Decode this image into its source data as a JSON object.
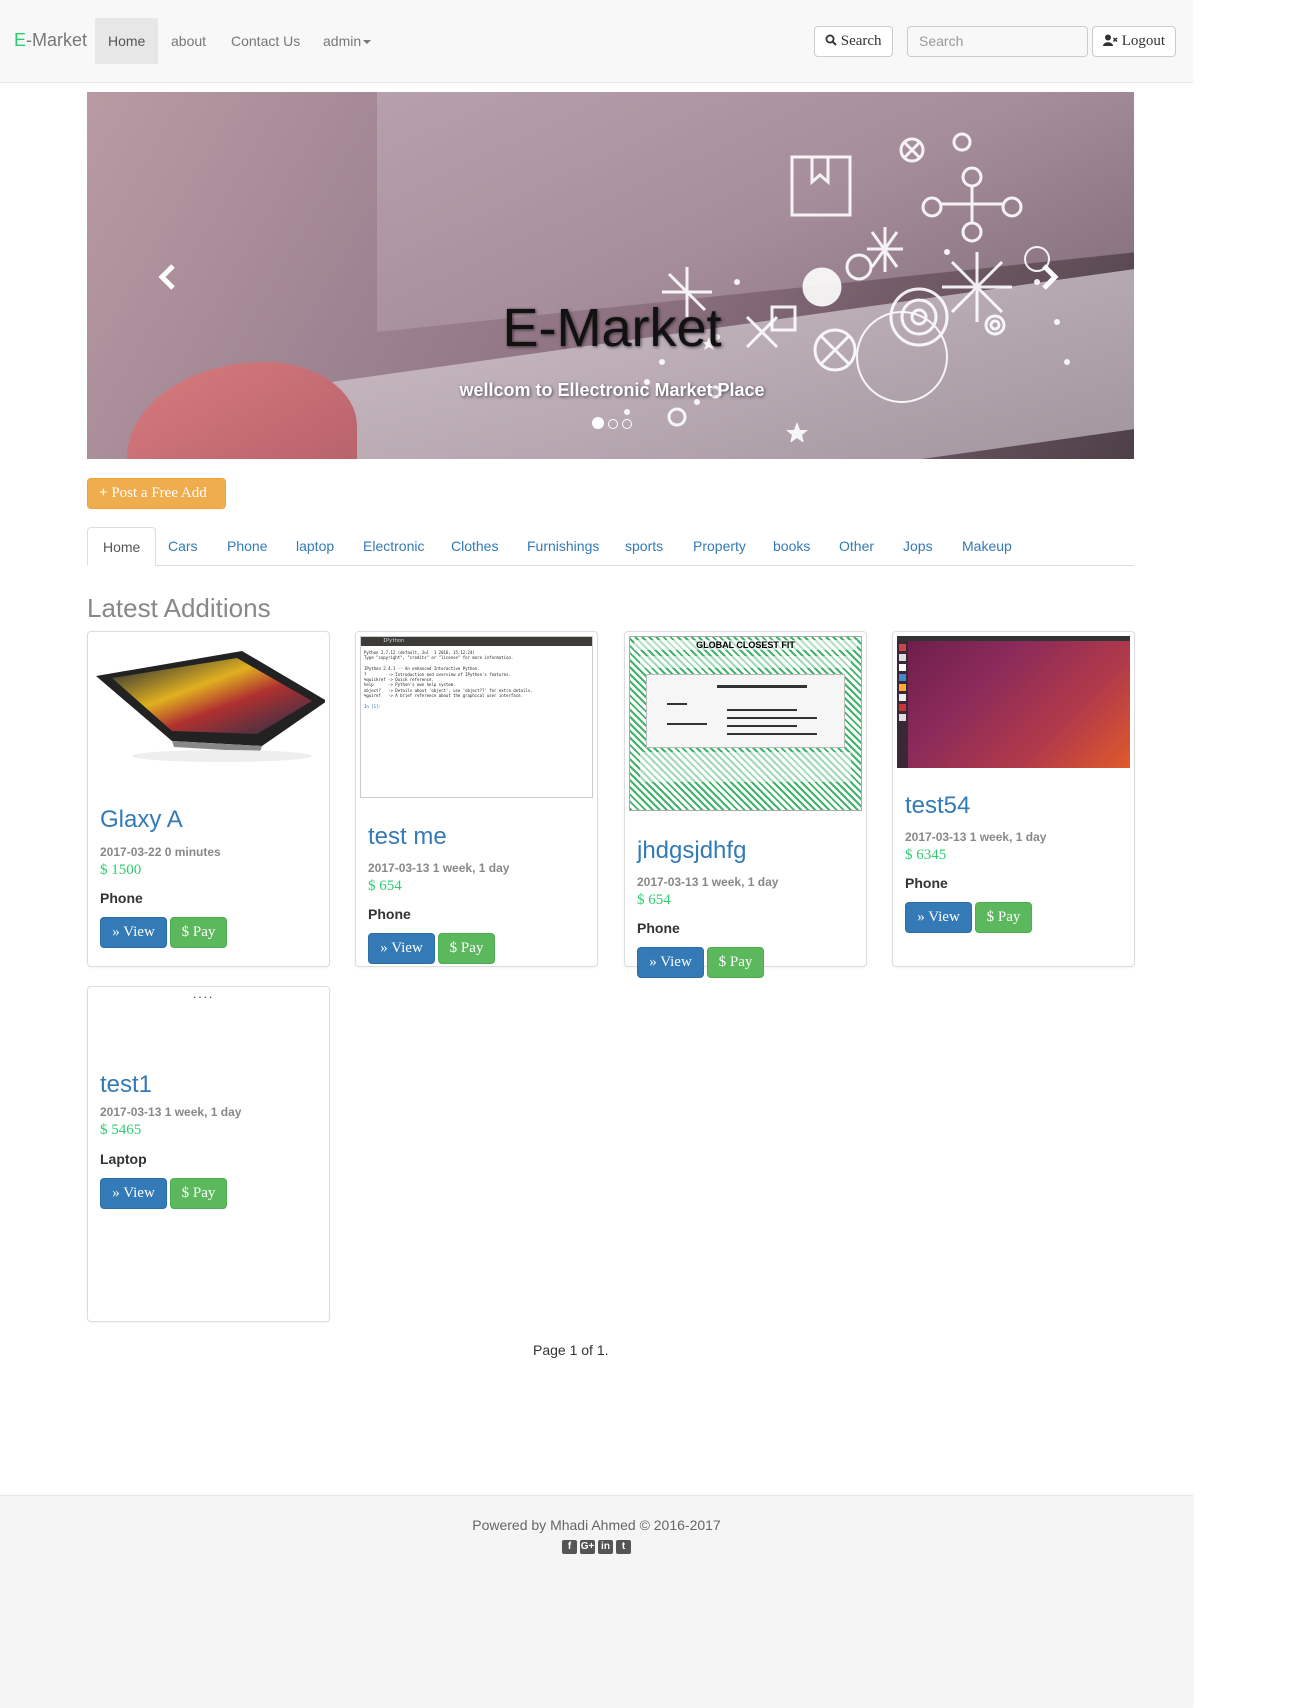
{
  "navbar": {
    "brand_e": "E",
    "brand_rest": "-Market",
    "items": [
      {
        "label": "Home",
        "active": true
      },
      {
        "label": "about"
      },
      {
        "label": "Contact Us"
      },
      {
        "label": "admin"
      }
    ],
    "search_button": "Search",
    "search_placeholder": "Search",
    "logout_button": "Logout"
  },
  "carousel": {
    "title": "E-Market",
    "subtitle": "wellcom to Ellectronic Market Place",
    "slide_count": 3,
    "active_slide": 1
  },
  "post_button": "Post a Free Add",
  "tabs": [
    "Home",
    "Cars",
    "Phone",
    "laptop",
    "Electronic",
    "Clothes",
    "Furnishings",
    "sports",
    "Property",
    "books",
    "Other",
    "Jops",
    "Makeup"
  ],
  "section_title": "Latest Additions",
  "cards": [
    {
      "title": "Glaxy A",
      "date": "2017-03-22 0 minutes",
      "price": "1500",
      "category": "Phone"
    },
    {
      "title": "test me",
      "date": "2017-03-13 1 week, 1 day",
      "price": "654",
      "category": "Phone"
    },
    {
      "title": "jhdgsjdhfg",
      "date": "2017-03-13 1 week, 1 day",
      "price": "654",
      "category": "Phone"
    },
    {
      "title": "test54",
      "date": "2017-03-13 1 week, 1 day",
      "price": "6345",
      "category": "Phone"
    },
    {
      "title": "test1",
      "date": "2017-03-13 1 week, 1 day",
      "price": "5465",
      "category": "Laptop"
    }
  ],
  "buttons": {
    "view": "View",
    "pay": "Pay",
    "currency": "$"
  },
  "thumb_text": {
    "formula_heading": "GLOBAL CLOSEST FIT",
    "ipython_title": "IPython",
    "ipython_lines": [
      "Python 2.7.12 (default, Jul  1 2016, 15:12:24)",
      "Type \"copyright\", \"credits\" or \"license\" for more information.",
      "IPython 2.4.1 -- An enhanced Interactive Python.",
      "?         -> Introduction and overview of IPython's features.",
      "%quickref -> Quick reference.",
      "help      -> Python's own help system.",
      "object?   -> Details about 'object', use 'object??' for extra details.",
      "%guiref   -> A brief reference about the graphical user interface.",
      "In [1]:"
    ]
  },
  "pagination": "Page 1 of 1.",
  "footer": {
    "text": "Powered by Mhadi Ahmed © 2016-2017",
    "social": [
      "facebook-icon",
      "google-plus-icon",
      "linkedin-icon",
      "twitter-icon"
    ]
  },
  "colors": {
    "brand_accent": "#2ecc71",
    "link": "#337ab7",
    "view_btn": "#337ab7",
    "pay_btn": "#5cb85c",
    "post_btn": "#f0ad4e"
  }
}
